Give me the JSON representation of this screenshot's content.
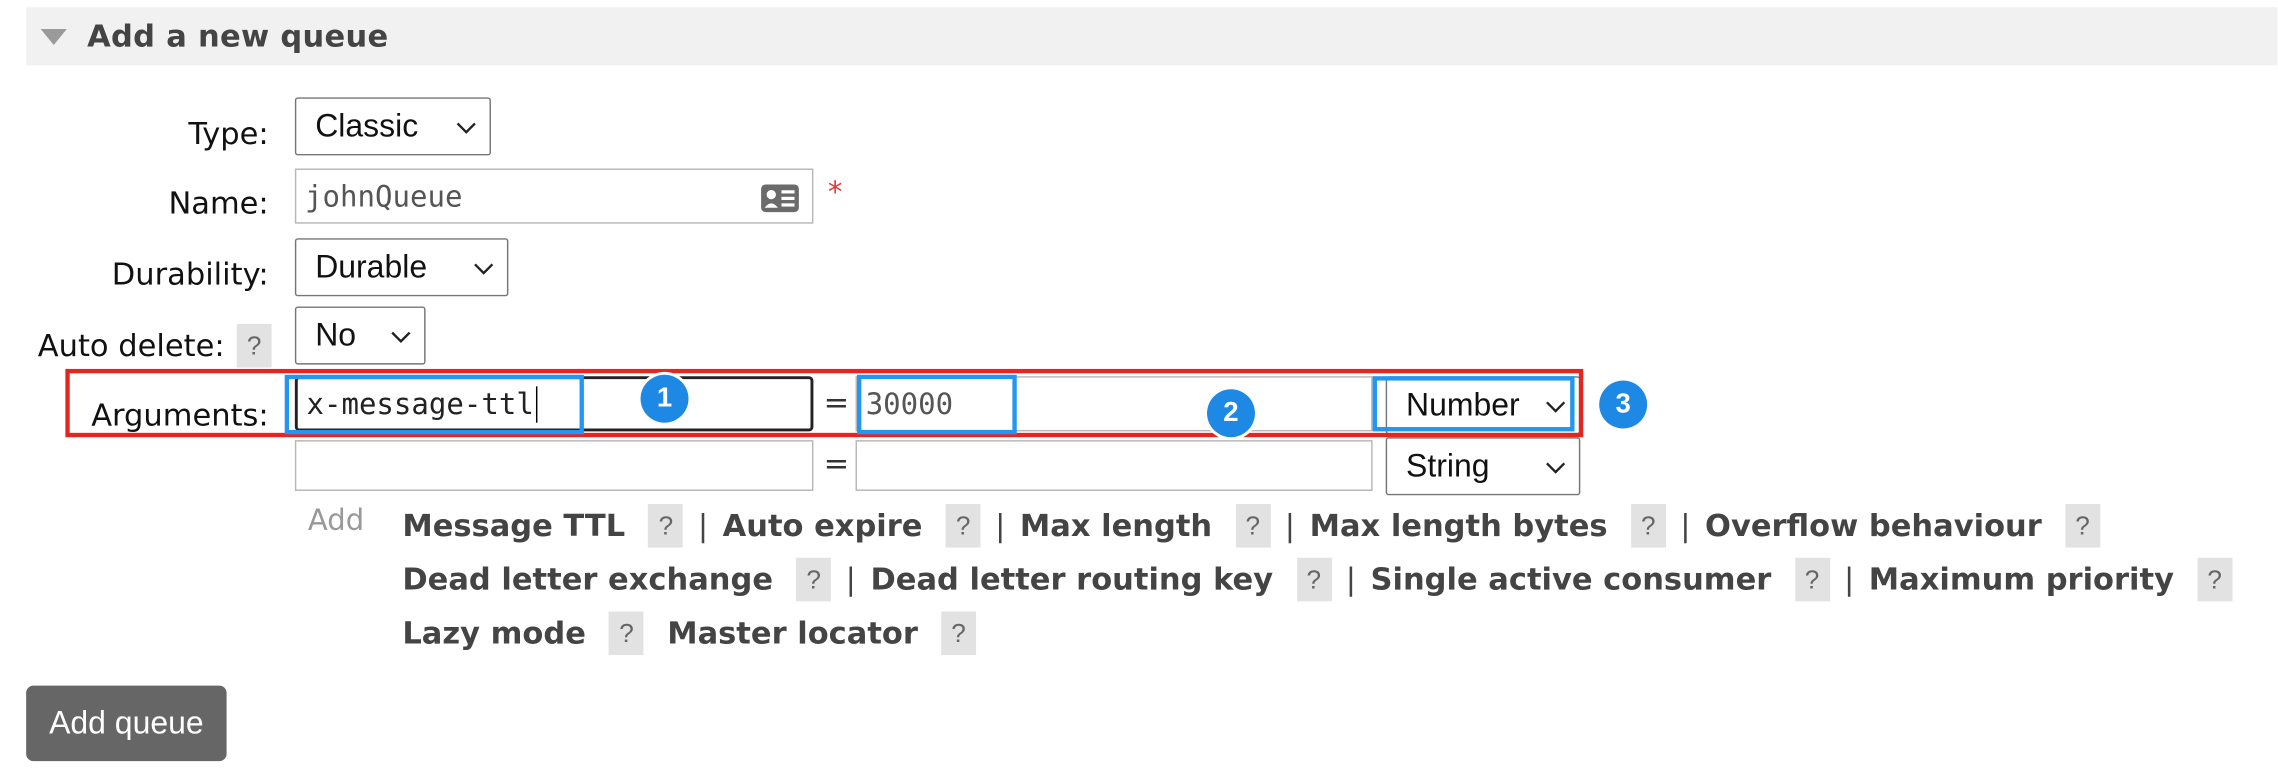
{
  "section": {
    "title": "Add a new queue"
  },
  "form": {
    "type_label": "Type:",
    "type_value": "Classic",
    "name_label": "Name:",
    "name_value": "johnQueue",
    "required_marker": "*",
    "durability_label": "Durability:",
    "durability_value": "Durable",
    "auto_delete_label": "Auto delete:",
    "auto_delete_help": "?",
    "auto_delete_value": "No",
    "arguments_label": "Arguments:",
    "arguments": [
      {
        "key": "x-message-ttl",
        "equals": "=",
        "value": "30000",
        "type": "Number"
      },
      {
        "key": "",
        "equals": "=",
        "value": "",
        "type": "String"
      }
    ],
    "add_label": "Add",
    "argument_links": [
      [
        "Message TTL",
        "Auto expire",
        "Max length",
        "Max length bytes",
        "Overflow behaviour"
      ],
      [
        "Dead letter exchange",
        "Dead letter routing key",
        "Single active consumer",
        "Maximum priority"
      ],
      [
        "Lazy mode",
        "Master locator"
      ]
    ],
    "help_glyph": "?",
    "separator": "|"
  },
  "annotations": {
    "badge_1": "1",
    "badge_2": "2",
    "badge_3": "3"
  },
  "submit": {
    "label": "Add queue"
  },
  "icons": {
    "collapse": "triangle-down-icon",
    "contact": "contact-card-icon",
    "dropdown": "chevron-down-icon"
  },
  "colors": {
    "highlight_red": "#e5261f",
    "highlight_blue": "#2196f3",
    "badge_blue": "#1e88e5",
    "button_gray": "#666666"
  }
}
